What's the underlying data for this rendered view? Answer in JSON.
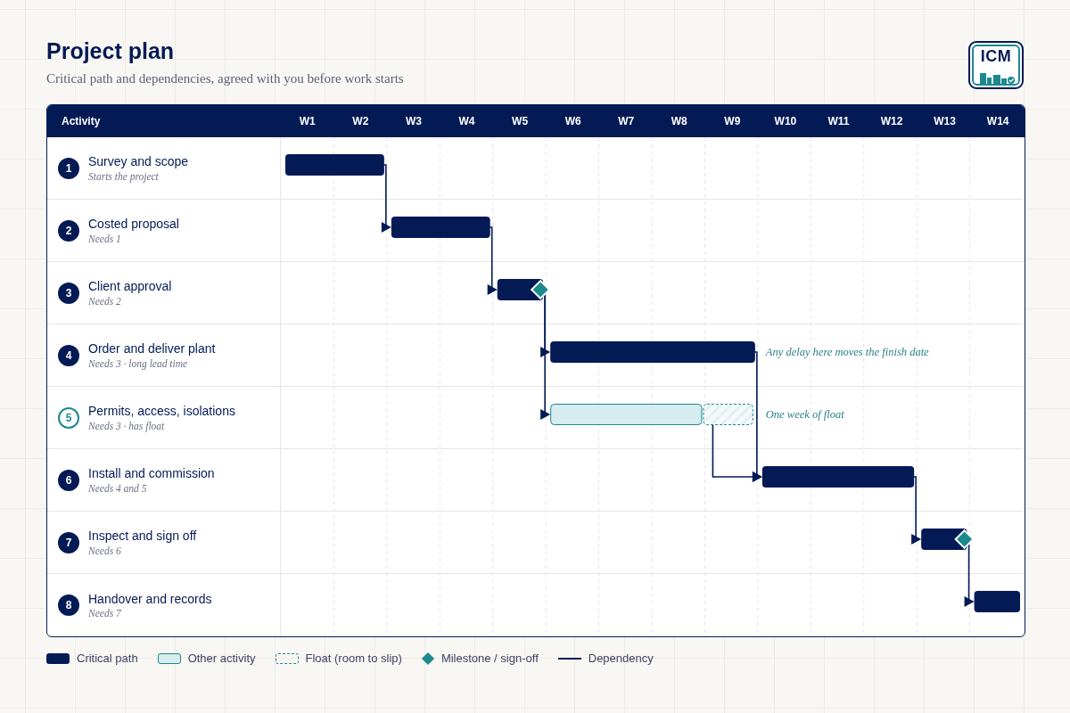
{
  "title": "Project plan",
  "subtitle": "Critical path and dependencies, agreed with you before work starts",
  "logo": {
    "text": "ICM"
  },
  "table": {
    "activity_heading": "Activity",
    "weeks": [
      "W1",
      "W2",
      "W3",
      "W4",
      "W5",
      "W6",
      "W7",
      "W8",
      "W9",
      "W10",
      "W11",
      "W12",
      "W13",
      "W14"
    ],
    "tasks": [
      {
        "number": "1",
        "name": "Survey and scope",
        "note": "Starts the project",
        "kind": "critical",
        "milestone": false
      },
      {
        "number": "2",
        "name": "Costed proposal",
        "note": "Needs 1",
        "kind": "critical",
        "milestone": false
      },
      {
        "number": "3",
        "name": "Client approval",
        "note": "Needs 2",
        "kind": "critical",
        "milestone": true
      },
      {
        "number": "4",
        "name": "Order and deliver plant",
        "note": "Needs 3 · long lead time",
        "kind": "critical",
        "milestone": false,
        "annotation": "Any delay here moves the finish date"
      },
      {
        "number": "5",
        "name": "Permits, access, isolations",
        "note": "Needs 3 · has float",
        "kind": "other",
        "milestone": false,
        "annotation": "One week of float"
      },
      {
        "number": "6",
        "name": "Install and commission",
        "note": "Needs 4 and 5",
        "kind": "critical",
        "milestone": false
      },
      {
        "number": "7",
        "name": "Inspect and sign off",
        "note": "Needs 6",
        "kind": "critical",
        "milestone": true
      },
      {
        "number": "8",
        "name": "Handover and records",
        "note": "Needs 7",
        "kind": "critical",
        "milestone": false
      }
    ]
  },
  "legend": [
    {
      "kind": "critical",
      "label": "Critical path"
    },
    {
      "kind": "other",
      "label": "Other activity"
    },
    {
      "kind": "float",
      "label": "Float (room to slip)"
    },
    {
      "kind": "milestone",
      "label": "Milestone / sign-off"
    },
    {
      "kind": "dependency",
      "label": "Dependency"
    }
  ]
}
